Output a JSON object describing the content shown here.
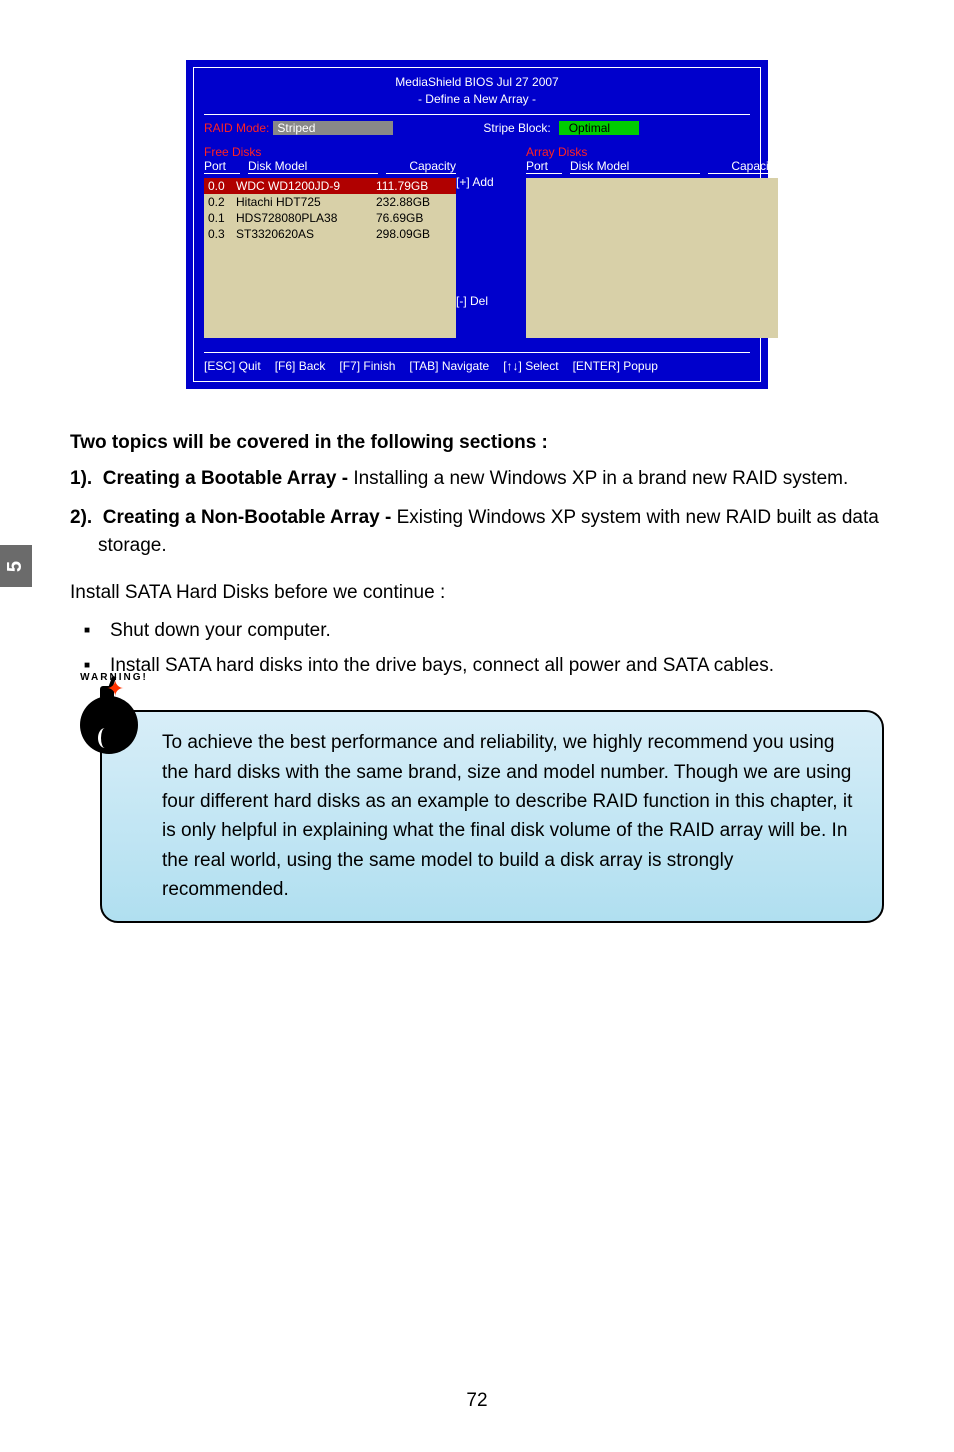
{
  "bios": {
    "title_line1": "MediaShield BIOS   Jul 27 2007",
    "title_line2": "- Define a New Array -",
    "raid_mode_label": "RAID Mode:",
    "raid_mode_value": "Striped",
    "stripe_block_label": "Stripe Block:",
    "stripe_block_value": "Optimal",
    "free_disks_label": "Free Disks",
    "array_disks_label": "Array Disks",
    "col_port": "Port",
    "col_model": "Disk Model",
    "col_capacity": "Capacity",
    "free_disks": [
      {
        "port": "0.0",
        "model": "WDC WD1200JD-9",
        "capacity": "111.79GB",
        "selected": true
      },
      {
        "port": "0.2",
        "model": "Hitachi HDT725",
        "capacity": "232.88GB",
        "selected": false
      },
      {
        "port": "0.1",
        "model": "HDS728080PLA38",
        "capacity": "76.69GB",
        "selected": false
      },
      {
        "port": "0.3",
        "model": "ST3320620AS",
        "capacity": "298.09GB",
        "selected": false
      }
    ],
    "add_btn": "[+] Add",
    "del_btn": "[-] Del",
    "footer": {
      "esc": "[ESC] Quit",
      "f6": "[F6] Back",
      "f7": "[F7] Finish",
      "tab": "[TAB] Navigate",
      "arrows": "[↑↓] Select",
      "enter": "[ENTER] Popup"
    }
  },
  "sidetab": "5",
  "topics_head": "Two topics will be covered in the following sections :",
  "item1_num": "1).",
  "item1_bold": "Creating a Bootable Array -",
  "item1_rest": " Installing a new Windows XP in a brand new RAID system.",
  "item2_num": "2).",
  "item2_bold": "Creating a Non-Bootable Array -",
  "item2_rest": " Existing Windows XP system with new RAID built as data storage.",
  "install_intro": "Install SATA Hard Disks before we continue :",
  "bullet1": "Shut down your computer.",
  "bullet2": "Install SATA hard disks into the drive bays, connect all power and SATA cables.",
  "warning_label": "WARNING!",
  "warning_text": "To achieve the best performance and reliability, we highly recommend you using the hard disks with the same brand, size and model number. Though we are using four different hard disks as an example to describe RAID function in this chapter, it is only helpful in explaining what the final disk volume of the RAID array will be. In the real world, using the same model to build a disk array is strongly recommended.",
  "page_number": "72"
}
